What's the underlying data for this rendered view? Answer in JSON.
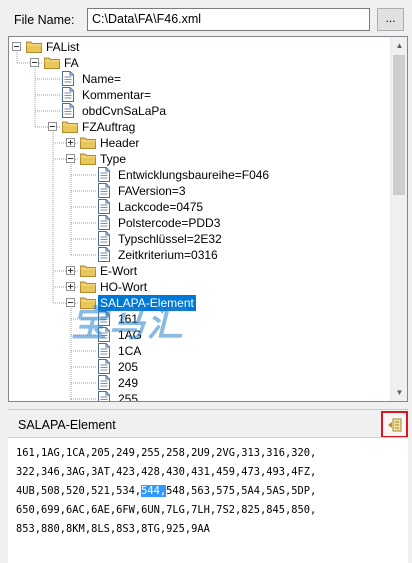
{
  "file": {
    "label": "File Name:",
    "path": "C:\\Data\\FA\\F46.xml",
    "browse_label": "..."
  },
  "tree": [
    {
      "label": "FAList",
      "type": "folder",
      "expander": "minus"
    },
    {
      "label": "FA",
      "type": "folder",
      "expander": "minus"
    },
    {
      "label": "Name=",
      "type": "doc"
    },
    {
      "label": "Kommentar=",
      "type": "doc"
    },
    {
      "label": "obdCvnSaLaPa",
      "type": "doc"
    },
    {
      "label": "FZAuftrag",
      "type": "folder",
      "expander": "minus"
    },
    {
      "label": "Header",
      "type": "folder",
      "expander": "plus"
    },
    {
      "label": "Type",
      "type": "folder",
      "expander": "minus"
    },
    {
      "label": "Entwicklungsbaureihe=F046",
      "type": "doc"
    },
    {
      "label": "FAVersion=3",
      "type": "doc"
    },
    {
      "label": "Lackcode=0475",
      "type": "doc"
    },
    {
      "label": "Polstercode=PDD3",
      "type": "doc"
    },
    {
      "label": "Typschlüssel=2E32",
      "type": "doc"
    },
    {
      "label": "Zeitkriterium=0316",
      "type": "doc"
    },
    {
      "label": "E-Wort",
      "type": "folder",
      "expander": "plus"
    },
    {
      "label": "HO-Wort",
      "type": "folder",
      "expander": "plus"
    },
    {
      "label": "SALAPA-Element",
      "type": "folder",
      "expander": "minus",
      "selected": true
    },
    {
      "label": "161",
      "type": "doc"
    },
    {
      "label": "1AG",
      "type": "doc"
    },
    {
      "label": "1CA",
      "type": "doc"
    },
    {
      "label": "205",
      "type": "doc"
    },
    {
      "label": "249",
      "type": "doc"
    },
    {
      "label": "255",
      "type": "doc"
    }
  ],
  "watermark": "宝马汇",
  "detail": {
    "title": "SALAPA-Element",
    "button_icon": "collapse-panel-icon",
    "lines": [
      {
        "pre": "161,1AG,1CA,205,249,255,258,2U9,2VG,313,316,320,",
        "hl": "",
        "post": ""
      },
      {
        "pre": "322,346,3AG,3AT,423,428,430,431,459,473,493,4FZ,",
        "hl": "",
        "post": ""
      },
      {
        "pre": "4UB,508,520,521,534,",
        "hl": "544,",
        "post": "548,563,575,5A4,5AS,5DP,"
      },
      {
        "pre": "650,699,6AC,6AE,6FW,6UN,7LG,7LH,7S2,825,845,850,",
        "hl": "",
        "post": ""
      },
      {
        "pre": "853,880,8KM,8LS,8S3,8TG,925,9AA",
        "hl": "",
        "post": ""
      }
    ],
    "highlight_color": "#3399ff",
    "button_border_color": "#e0141c"
  },
  "selection_color": "#0078d7"
}
